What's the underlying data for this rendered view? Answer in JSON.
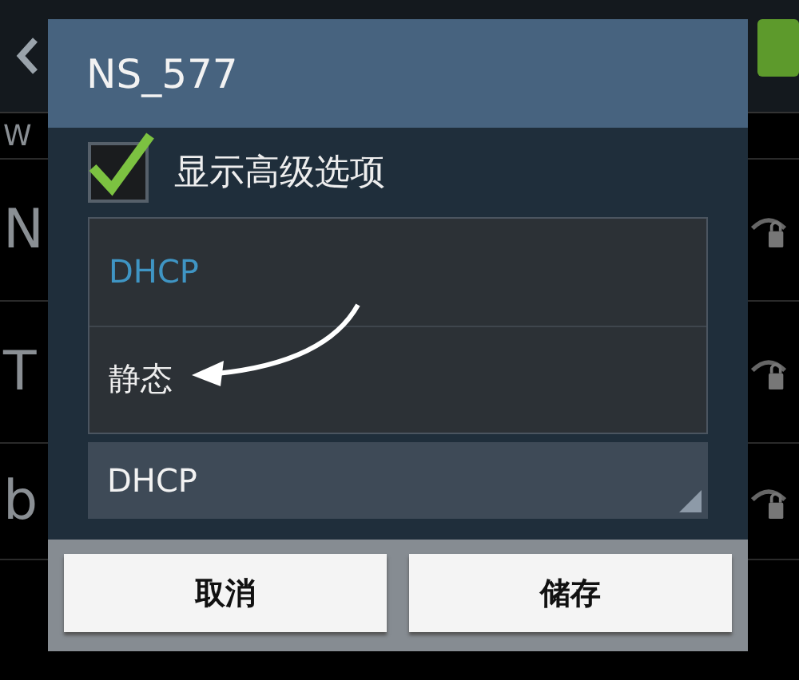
{
  "background": {
    "switch_on": true,
    "rows": [
      {
        "text": "W",
        "locked": false
      },
      {
        "text": "N",
        "locked": true
      },
      {
        "text": "T",
        "locked": true
      },
      {
        "text": "b",
        "locked": true
      }
    ]
  },
  "dialog": {
    "title": "NS_577",
    "show_advanced": {
      "label": "显示高级选项",
      "checked": true
    },
    "options": [
      {
        "label": "DHCP",
        "selected": true
      },
      {
        "label": "静态",
        "selected": false
      }
    ],
    "ip_setting": {
      "value": "DHCP"
    },
    "buttons": [
      {
        "label": "取消"
      },
      {
        "label": "储存"
      }
    ]
  }
}
